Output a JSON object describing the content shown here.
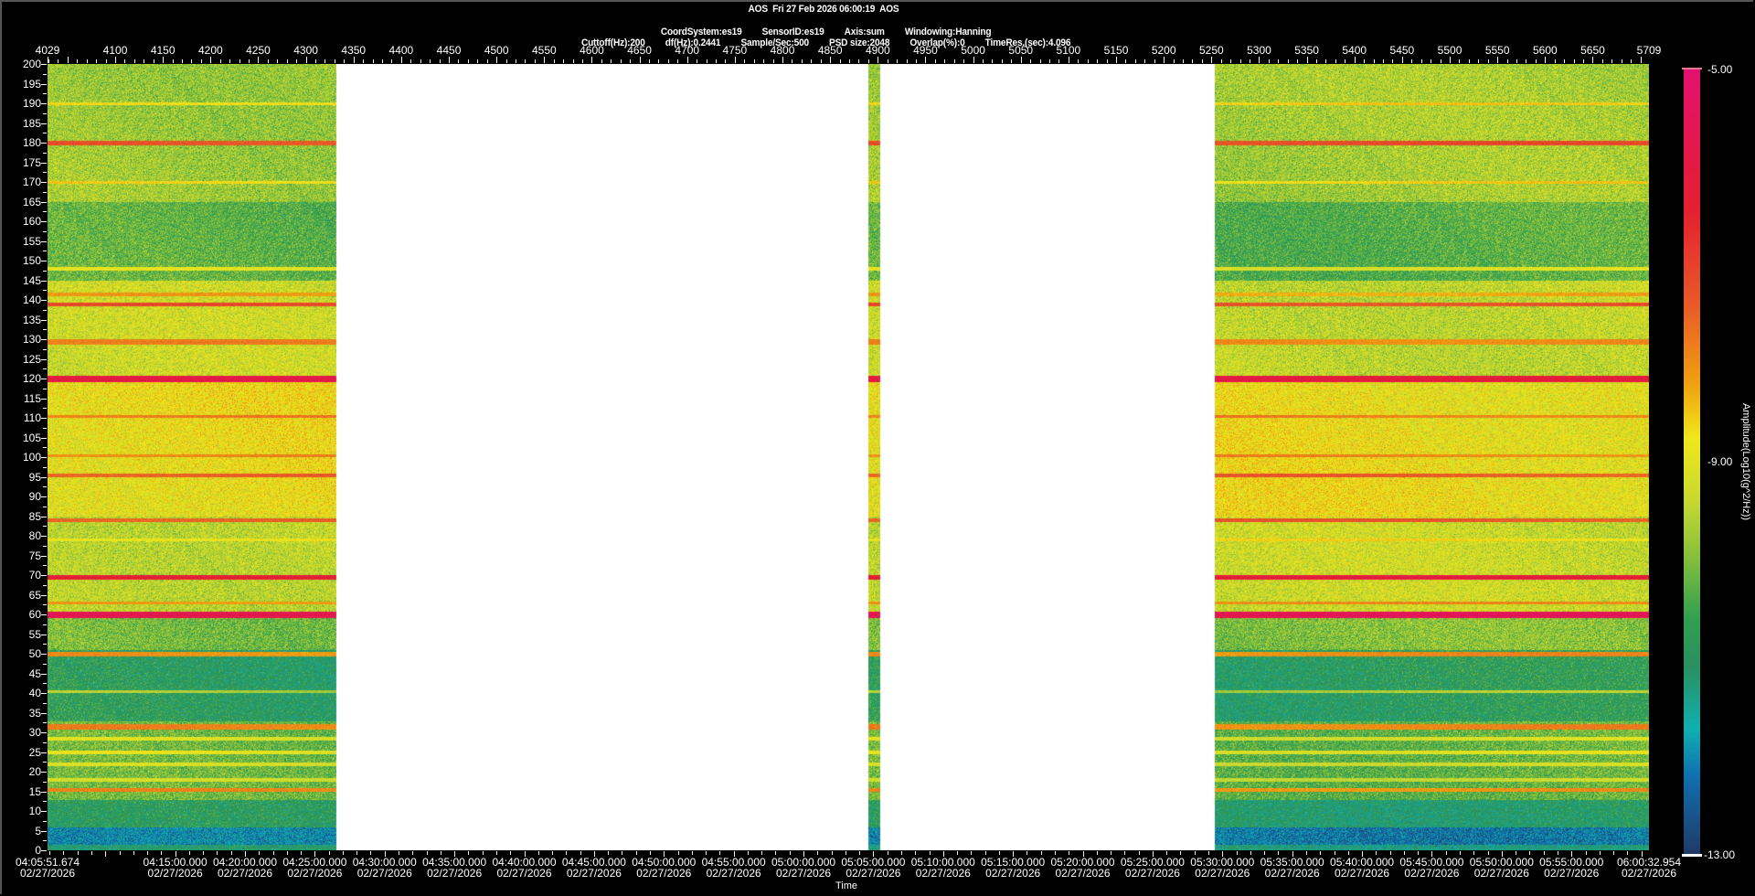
{
  "header": {
    "title": "AOS  Fri 27 Feb 2026 06:00:19  AOS",
    "line2": [
      "CoordSystem:es19",
      "SensorID:es19",
      "Axis:sum",
      "Windowing:Hanning"
    ],
    "line3": [
      "Cuttoff(Hz):200",
      "df(Hz):0.2441",
      "Sample/Sec:500",
      "PSD size:2048",
      "Overlap(%):0",
      "TimeRes.(sec):4.096"
    ]
  },
  "chart_data": {
    "type": "heatmap",
    "title": "AOS  Fri 27 Feb 2026 06:00:19  AOS",
    "xlabel": "Time",
    "ylabel": "",
    "colorbar_label": "Amplitude(Log10(g^2/Hz))",
    "colorbar_ticks": [
      "-5.00",
      "-9.00",
      "-13.00"
    ],
    "zlim": [
      -13,
      -5
    ],
    "ylim": [
      0,
      200
    ],
    "y_ticks": [
      "0",
      "5",
      "10",
      "15",
      "20",
      "25",
      "30",
      "35",
      "40",
      "45",
      "50",
      "55",
      "60",
      "65",
      "70",
      "75",
      "80",
      "85",
      "90",
      "95",
      "100",
      "105",
      "110",
      "115",
      "120",
      "125",
      "130",
      "135",
      "140",
      "145",
      "150",
      "155",
      "160",
      "165",
      "170",
      "175",
      "180",
      "185",
      "190",
      "195",
      "200"
    ],
    "top_axis": {
      "range": [
        4029,
        5709
      ],
      "labels": [
        "4029",
        "4100",
        "4150",
        "4200",
        "4250",
        "4300",
        "4350",
        "4400",
        "4450",
        "4500",
        "4550",
        "4600",
        "4650",
        "4700",
        "4750",
        "4800",
        "4850",
        "4900",
        "4950",
        "5000",
        "5050",
        "5100",
        "5150",
        "5200",
        "5250",
        "5300",
        "5350",
        "5400",
        "5450",
        "5500",
        "5550",
        "5600",
        "5650",
        "5709"
      ]
    },
    "time_range": [
      "04:05:51.674",
      "06:00:32.954"
    ],
    "time_labels": [
      {
        "time": "04:05:51.674",
        "date": "02/27/2026"
      },
      {
        "time": "04:15:00.000",
        "date": "02/27/2026"
      },
      {
        "time": "04:20:00.000",
        "date": "02/27/2026"
      },
      {
        "time": "04:25:00.000",
        "date": "02/27/2026"
      },
      {
        "time": "04:30:00.000",
        "date": "02/27/2026"
      },
      {
        "time": "04:35:00.000",
        "date": "02/27/2026"
      },
      {
        "time": "04:40:00.000",
        "date": "02/27/2026"
      },
      {
        "time": "04:45:00.000",
        "date": "02/27/2026"
      },
      {
        "time": "04:50:00.000",
        "date": "02/27/2026"
      },
      {
        "time": "04:55:00.000",
        "date": "02/27/2026"
      },
      {
        "time": "05:00:00.000",
        "date": "02/27/2026"
      },
      {
        "time": "05:05:00.000",
        "date": "02/27/2026"
      },
      {
        "time": "05:10:00.000",
        "date": "02/27/2026"
      },
      {
        "time": "05:15:00.000",
        "date": "02/27/2026"
      },
      {
        "time": "05:20:00.000",
        "date": "02/27/2026"
      },
      {
        "time": "05:25:00.000",
        "date": "02/27/2026"
      },
      {
        "time": "05:30:00.000",
        "date": "02/27/2026"
      },
      {
        "time": "05:35:00.000",
        "date": "02/27/2026"
      },
      {
        "time": "05:40:00.000",
        "date": "02/27/2026"
      },
      {
        "time": "05:45:00.000",
        "date": "02/27/2026"
      },
      {
        "time": "05:50:00.000",
        "date": "02/27/2026"
      },
      {
        "time": "05:55:00.000",
        "date": "02/27/2026"
      },
      {
        "time": "06:00:32.954",
        "date": "02/27/2026"
      }
    ],
    "data_segments": [
      [
        "04:05:51.674",
        "04:26:29"
      ],
      [
        "05:04:38",
        "05:05:26"
      ],
      [
        "05:29:27",
        "06:00:32.954"
      ]
    ],
    "background_bands": [
      {
        "from": 165,
        "to": 200,
        "amp": -9.7
      },
      {
        "from": 145,
        "to": 165,
        "amp": -10.3
      },
      {
        "from": 120,
        "to": 145,
        "amp": -9.35
      },
      {
        "from": 85,
        "to": 120,
        "amp": -8.85
      },
      {
        "from": 60,
        "to": 85,
        "amp": -9.35
      },
      {
        "from": 51,
        "to": 60,
        "amp": -10.0
      },
      {
        "from": 33,
        "to": 51,
        "amp": -10.9
      },
      {
        "from": 13,
        "to": 33,
        "amp": -10.2
      },
      {
        "from": 6,
        "to": 13,
        "amp": -11.0
      },
      {
        "from": 1.5,
        "to": 6,
        "amp": -12.1
      },
      {
        "from": 0,
        "to": 1.5,
        "amp": -11.2
      }
    ],
    "tonal_lines": [
      {
        "hz": 190,
        "amp": -8.6,
        "bw": 0.6
      },
      {
        "hz": 180,
        "amp": -7.2,
        "bw": 0.8
      },
      {
        "hz": 170,
        "amp": -8.6,
        "bw": 0.6
      },
      {
        "hz": 148,
        "amp": -9.0,
        "bw": 0.6
      },
      {
        "hz": 141.5,
        "amp": -8.2,
        "bw": 0.6
      },
      {
        "hz": 139,
        "amp": -7.2,
        "bw": 0.8
      },
      {
        "hz": 129.5,
        "amp": -7.9,
        "bw": 1.1
      },
      {
        "hz": 120,
        "amp": -6.0,
        "bw": 1.2
      },
      {
        "hz": 110.5,
        "amp": -7.8,
        "bw": 0.5
      },
      {
        "hz": 100.5,
        "amp": -7.9,
        "bw": 0.5
      },
      {
        "hz": 95.5,
        "amp": -7.4,
        "bw": 0.6
      },
      {
        "hz": 84,
        "amp": -7.4,
        "bw": 0.6
      },
      {
        "hz": 79,
        "amp": -8.7,
        "bw": 0.5
      },
      {
        "hz": 69.5,
        "amp": -6.2,
        "bw": 1.0
      },
      {
        "hz": 63,
        "amp": -8.0,
        "bw": 0.6
      },
      {
        "hz": 60,
        "amp": -5.6,
        "bw": 1.2
      },
      {
        "hz": 50,
        "amp": -8.0,
        "bw": 0.8
      },
      {
        "hz": 40.5,
        "amp": -9.6,
        "bw": 0.5
      },
      {
        "hz": 31.5,
        "amp": -7.9,
        "bw": 1.1
      },
      {
        "hz": 28.5,
        "amp": -9.1,
        "bw": 0.8
      },
      {
        "hz": 25,
        "amp": -9.0,
        "bw": 0.8
      },
      {
        "hz": 22,
        "amp": -9.2,
        "bw": 0.8
      },
      {
        "hz": 18,
        "amp": -9.3,
        "bw": 0.8
      },
      {
        "hz": 15.5,
        "amp": -8.0,
        "bw": 0.8
      }
    ],
    "colormap": [
      "#e2106e",
      "#e42030",
      "#e85a28",
      "#f0a010",
      "#f0e81a",
      "#c8d830",
      "#88c03c",
      "#30a050",
      "#2a9060",
      "#10b0b0",
      "#1070b0",
      "#203a68"
    ]
  }
}
